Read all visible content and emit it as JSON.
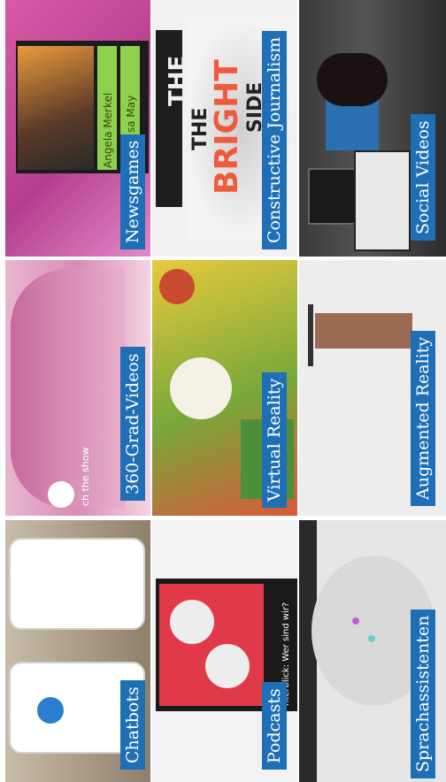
{
  "tiles": [
    {
      "label": "Newsgames",
      "names": [
        "Angela Merkel",
        "sa May"
      ]
    },
    {
      "label": "Constructive Journalism",
      "words": [
        "THE",
        "THE",
        "BRIGHT",
        "SIDE"
      ]
    },
    {
      "label": "Social Videos"
    },
    {
      "label": "360-Grad-Videos",
      "caption": "ch the show"
    },
    {
      "label": "Virtual Reality"
    },
    {
      "label": "Augmented Reality"
    },
    {
      "label": "Chatbots"
    },
    {
      "label": "Podcasts",
      "caption": "nterblick: Wer sind wir?"
    },
    {
      "label": "Sprachassistenten"
    }
  ],
  "colors": {
    "label_bg": "#1e6fb5"
  }
}
